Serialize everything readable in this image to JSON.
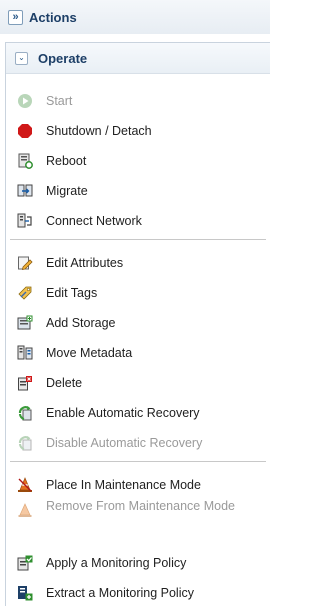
{
  "header": {
    "title": "Actions",
    "collapse_glyph": "»"
  },
  "section": {
    "title": "Operate",
    "toggle_glyph": "⌄"
  },
  "items": [
    {
      "id": "start",
      "label": "Start",
      "icon": "play-icon",
      "enabled": false
    },
    {
      "id": "shutdown",
      "label": "Shutdown / Detach",
      "icon": "stop-octagon-icon",
      "enabled": true
    },
    {
      "id": "reboot",
      "label": "Reboot",
      "icon": "reboot-icon",
      "enabled": true
    },
    {
      "id": "migrate",
      "label": "Migrate",
      "icon": "migrate-icon",
      "enabled": true
    },
    {
      "id": "connect-network",
      "label": "Connect Network",
      "icon": "network-icon",
      "enabled": true
    },
    {
      "id": "edit-attributes",
      "label": "Edit Attributes",
      "icon": "edit-pencil-icon",
      "enabled": true
    },
    {
      "id": "edit-tags",
      "label": "Edit Tags",
      "icon": "tag-icon",
      "enabled": true
    },
    {
      "id": "add-storage",
      "label": "Add Storage",
      "icon": "storage-icon",
      "enabled": true
    },
    {
      "id": "move-metadata",
      "label": "Move Metadata",
      "icon": "metadata-icon",
      "enabled": true
    },
    {
      "id": "delete",
      "label": "Delete",
      "icon": "delete-icon",
      "enabled": true
    },
    {
      "id": "enable-recovery",
      "label": "Enable Automatic Recovery",
      "icon": "recovery-icon",
      "enabled": true
    },
    {
      "id": "disable-recovery",
      "label": "Disable Automatic Recovery",
      "icon": "recovery-icon",
      "enabled": false
    },
    {
      "id": "maintenance-on",
      "label": "Place In Maintenance Mode",
      "icon": "maintenance-cone-icon",
      "enabled": true
    },
    {
      "id": "maintenance-off",
      "label": "Remove From Maintenance Mode",
      "icon": "maintenance-bell-icon",
      "enabled": false
    },
    {
      "id": "apply-policy",
      "label": "Apply a Monitoring Policy",
      "icon": "apply-policy-icon",
      "enabled": true
    },
    {
      "id": "extract-policy",
      "label": "Extract a Monitoring Policy",
      "icon": "extract-policy-icon",
      "enabled": true
    }
  ],
  "colors": {
    "link_blue": "#1d3f67",
    "disabled_text": "#9a9a9a",
    "stop_red": "#d01818",
    "recovery_green": "#3a9a3a",
    "maintenance_orange": "#e3701e"
  }
}
